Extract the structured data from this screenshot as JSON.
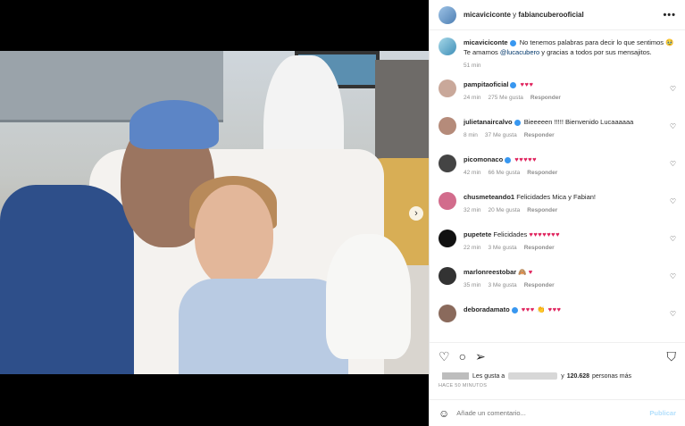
{
  "post": {
    "header": {
      "user1": "micaviciconte",
      "separator": " y ",
      "user2": "fabiancuberooficial",
      "more_icon": "more-horizontal-icon"
    },
    "caption": {
      "user": "micaviciconte",
      "text": "No tenemos palabras para decir lo que sentimos",
      "emoji": "🥹",
      "line2_prefix": "Te amamos ",
      "mention": "@lucacubero",
      "line2_suffix": " y gracias a todos por sus mensajitos.",
      "time": "51 min"
    },
    "comments": [
      {
        "user": "pampitaoficial",
        "verified": true,
        "text": "",
        "hearts": "♥♥♥",
        "time": "24 min",
        "likes": "275 Me gusta",
        "reply": "Responder",
        "avatar_color": "#c9a89a"
      },
      {
        "user": "julietanaircalvo",
        "verified": true,
        "text": "Bieeeeen !!!!! Bienvenido Lucaaaaaa",
        "hearts": "",
        "time": "8 min",
        "likes": "37 Me gusta",
        "reply": "Responder",
        "avatar_color": "#b58b7a"
      },
      {
        "user": "picomonaco",
        "verified": true,
        "text": "",
        "hearts": "♥♥♥♥♥",
        "time": "42 min",
        "likes": "66 Me gusta",
        "reply": "Responder",
        "avatar_color": "#444"
      },
      {
        "user": "chusmeteando1",
        "verified": false,
        "text": "Felicidades Mica y Fabian!",
        "hearts": "",
        "time": "32 min",
        "likes": "20 Me gusta",
        "reply": "Responder",
        "avatar_color": "#d26c8c"
      },
      {
        "user": "pupetete",
        "verified": false,
        "text": "Felicidades ",
        "hearts": "♥♥♥♥♥♥♥",
        "time": "22 min",
        "likes": "3 Me gusta",
        "reply": "Responder",
        "avatar_color": "#111"
      },
      {
        "user": "marlonreestobar",
        "verified": false,
        "text": "🙈 ",
        "hearts": "♥",
        "time": "35 min",
        "likes": "3 Me gusta",
        "reply": "Responder",
        "avatar_color": "#333"
      },
      {
        "user": "deboradamato",
        "verified": true,
        "text": "",
        "hearts": "♥♥♥ 👏 ♥♥♥",
        "time": "",
        "likes": "",
        "reply": "",
        "avatar_color": "#8a6a5c"
      }
    ],
    "likes": {
      "prefix": "Les gusta a",
      "connector": "y",
      "count": "120.628",
      "suffix": "personas más"
    },
    "time_ago": "Hace 50 minutos",
    "add_comment": {
      "placeholder": "Añade un comentario...",
      "publish": "Publicar"
    },
    "icons": {
      "like": "heart-icon",
      "comment": "comment-icon",
      "share": "send-icon",
      "save": "bookmark-icon"
    }
  }
}
